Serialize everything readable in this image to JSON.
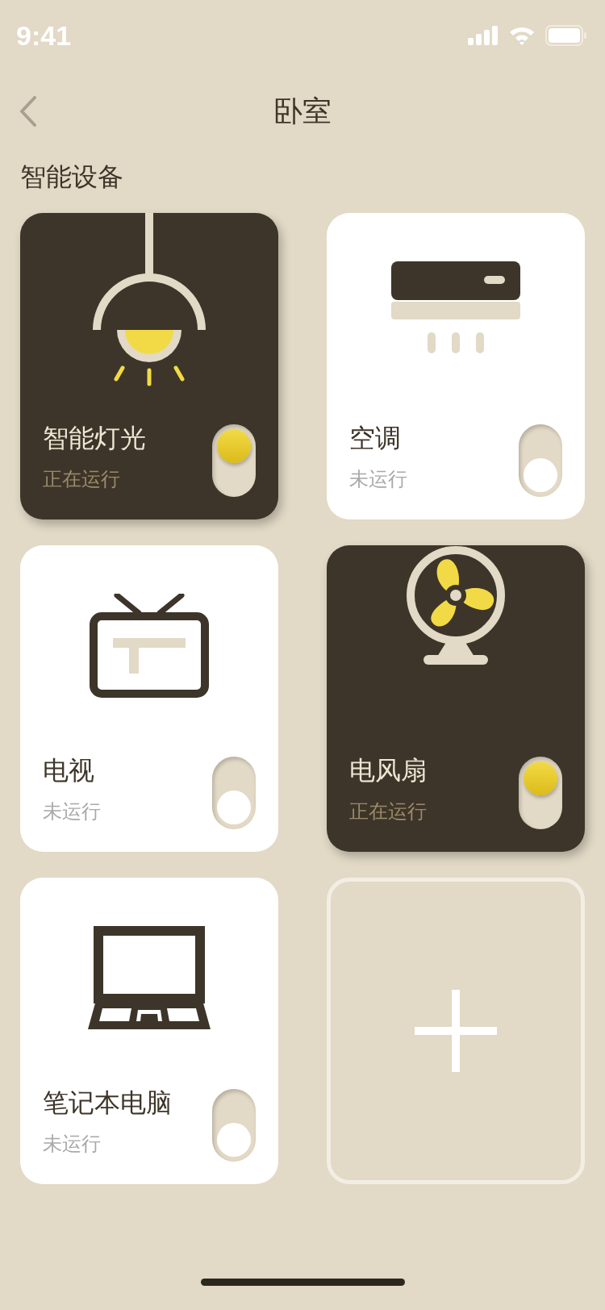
{
  "status_bar": {
    "time": "9:41"
  },
  "header": {
    "title": "卧室"
  },
  "section": {
    "title": "智能设备"
  },
  "devices": [
    {
      "kind": "lamp",
      "name": "智能灯光",
      "status": "正在运行",
      "on": true
    },
    {
      "kind": "ac",
      "name": "空调",
      "status": "未运行",
      "on": false
    },
    {
      "kind": "tv",
      "name": "电视",
      "status": "未运行",
      "on": false
    },
    {
      "kind": "fan",
      "name": "电风扇",
      "status": "正在运行",
      "on": true
    },
    {
      "kind": "laptop",
      "name": "笔记本电脑",
      "status": "未运行",
      "on": false
    }
  ]
}
